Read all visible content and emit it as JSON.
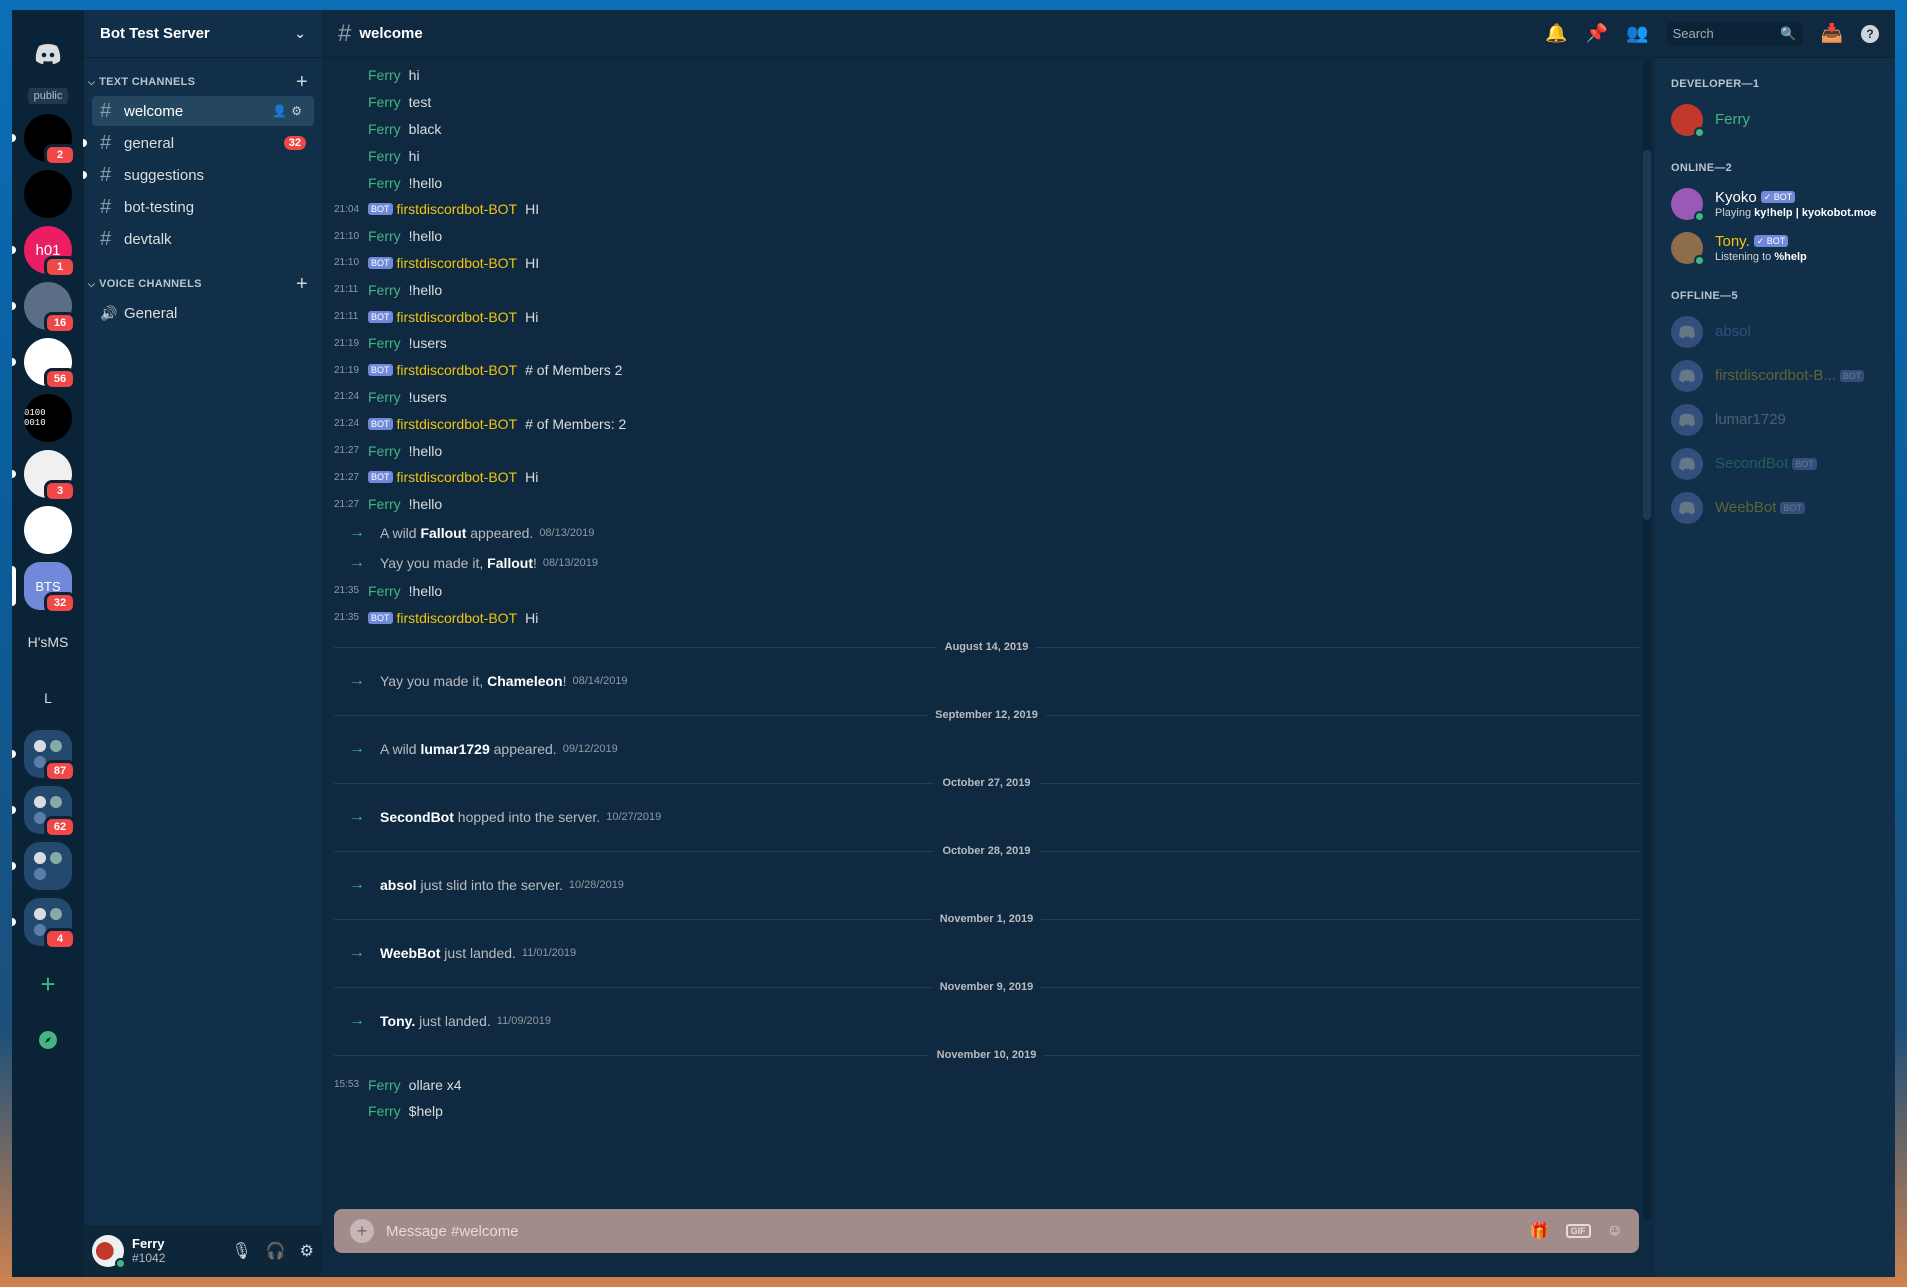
{
  "guilds": {
    "public_label": "public",
    "items": [
      {
        "badge": "2",
        "bg": "#000000"
      },
      {
        "badge": "",
        "bg": "#000000"
      },
      {
        "label": "h01",
        "badge": "1",
        "bg": "#e91e63"
      },
      {
        "badge": "16",
        "bg": "#5a6f85"
      },
      {
        "badge": "56",
        "bg": "#ffffff"
      },
      {
        "label": "0100 0010",
        "badge": "",
        "bg": "#000000"
      },
      {
        "badge": "3",
        "bg": "#f0f0f0"
      },
      {
        "badge": "",
        "bg": "#ffffff"
      }
    ],
    "selected": {
      "label": "BTS",
      "badge": "32"
    },
    "text_items": [
      "H'sMS",
      "L"
    ],
    "folders": [
      {
        "badge": "87"
      },
      {
        "badge": "62"
      },
      {
        "badge": ""
      },
      {
        "badge": "4"
      }
    ]
  },
  "server": {
    "name": "Bot Test Server",
    "text_category": "TEXT CHANNELS",
    "voice_category": "VOICE CHANNELS",
    "text_channels": [
      {
        "name": "welcome"
      },
      {
        "name": "general",
        "badge": "32"
      },
      {
        "name": "suggestions"
      },
      {
        "name": "bot-testing"
      },
      {
        "name": "devtalk"
      }
    ],
    "voice_channels": [
      {
        "name": "General"
      }
    ]
  },
  "user": {
    "name": "Ferry",
    "disc": "#1042"
  },
  "channel": {
    "title": "welcome"
  },
  "search": {
    "placeholder": "Search"
  },
  "composer": {
    "placeholder": "Message #welcome"
  },
  "messages_top": [
    {
      "ts": "",
      "author": "Ferry",
      "text": "hi",
      "bot": false
    },
    {
      "ts": "",
      "author": "Ferry",
      "text": "test",
      "bot": false
    },
    {
      "ts": "",
      "author": "Ferry",
      "text": "black",
      "bot": false
    },
    {
      "ts": "",
      "author": "Ferry",
      "text": "hi",
      "bot": false
    },
    {
      "ts": "",
      "author": "Ferry",
      "text": "!hello",
      "bot": false
    },
    {
      "ts": "21:04",
      "author": "firstdiscordbot-BOT",
      "text": "HI",
      "bot": true
    },
    {
      "ts": "21:10",
      "author": "Ferry",
      "text": "!hello",
      "bot": false
    },
    {
      "ts": "21:10",
      "author": "firstdiscordbot-BOT",
      "text": "HI",
      "bot": true
    },
    {
      "ts": "21:11",
      "author": "Ferry",
      "text": "!hello",
      "bot": false
    },
    {
      "ts": "21:11",
      "author": "firstdiscordbot-BOT",
      "text": "Hi",
      "bot": true
    },
    {
      "ts": "21:19",
      "author": "Ferry",
      "text": "!users",
      "bot": false
    },
    {
      "ts": "21:19",
      "author": "firstdiscordbot-BOT",
      "text": "# of Members 2",
      "bot": true
    },
    {
      "ts": "21:24",
      "author": "Ferry",
      "text": "!users",
      "bot": false
    },
    {
      "ts": "21:24",
      "author": "firstdiscordbot-BOT",
      "text": "# of Members: 2",
      "bot": true
    },
    {
      "ts": "21:27",
      "author": "Ferry",
      "text": "!hello",
      "bot": false
    },
    {
      "ts": "21:27",
      "author": "firstdiscordbot-BOT",
      "text": "Hi",
      "bot": true
    },
    {
      "ts": "21:27",
      "author": "Ferry",
      "text": "!hello",
      "bot": false
    }
  ],
  "sys_inline": [
    {
      "pre": "A wild ",
      "name": "Fallout",
      "post": " appeared.",
      "date": "08/13/2019"
    },
    {
      "pre": "Yay you made it, ",
      "name": "Fallout",
      "post": "!",
      "date": "08/13/2019"
    }
  ],
  "messages_mid": [
    {
      "ts": "21:35",
      "author": "Ferry",
      "text": "!hello",
      "bot": false
    },
    {
      "ts": "21:35",
      "author": "firstdiscordbot-BOT",
      "text": "Hi",
      "bot": true
    }
  ],
  "day_sections": [
    {
      "date": "August 14, 2019",
      "pre": "Yay you made it, ",
      "name": "Chameleon",
      "post": "!",
      "stamp": "08/14/2019"
    },
    {
      "date": "September 12, 2019",
      "pre": "A wild ",
      "name": "lumar1729",
      "post": " appeared.",
      "stamp": "09/12/2019"
    },
    {
      "date": "October 27, 2019",
      "pre": "",
      "name": "SecondBot",
      "post": " hopped into the server.",
      "stamp": "10/27/2019"
    },
    {
      "date": "October 28, 2019",
      "pre": "",
      "name": "absol",
      "post": " just slid into the server.",
      "stamp": "10/28/2019"
    },
    {
      "date": "November 1, 2019",
      "pre": "",
      "name": "WeebBot",
      "post": " just landed.",
      "stamp": "11/01/2019"
    },
    {
      "date": "November 9, 2019",
      "pre": "",
      "name": "Tony.",
      "post": " just landed.",
      "stamp": "11/09/2019"
    }
  ],
  "last_day": {
    "date": "November 10, 2019",
    "messages": [
      {
        "ts": "15:53",
        "author": "Ferry",
        "text": "ollare x4",
        "bot": false
      },
      {
        "ts": "",
        "author": "Ferry",
        "text": "$help",
        "bot": false
      }
    ]
  },
  "members": {
    "developer_label": "DEVELOPER—1",
    "developer": [
      {
        "name": "Ferry",
        "color": "#43b581"
      }
    ],
    "online_label": "ONLINE—2",
    "online": [
      {
        "name": "Kyoko",
        "tag": "✓ BOT",
        "activity_pre": "Playing ",
        "activity_bold": "ky!help | kyokobot.moe",
        "color": "#ffffff"
      },
      {
        "name": "Tony.",
        "tag": "✓ BOT",
        "activity_pre": "Listening to ",
        "activity_bold": "%help",
        "color": "#f1c40f"
      }
    ],
    "offline_label": "OFFLINE—5",
    "offline": [
      {
        "name": "absol",
        "tag": "",
        "color": "#7289da"
      },
      {
        "name": "firstdiscordbot-B...",
        "tag": "BOT",
        "color": "#f1c40f"
      },
      {
        "name": "lumar1729",
        "tag": "",
        "color": "#b9bbbe"
      },
      {
        "name": "SecondBot",
        "tag": "BOT",
        "color": "#43b581"
      },
      {
        "name": "WeebBot",
        "tag": "BOT",
        "color": "#f1c40f"
      }
    ]
  }
}
